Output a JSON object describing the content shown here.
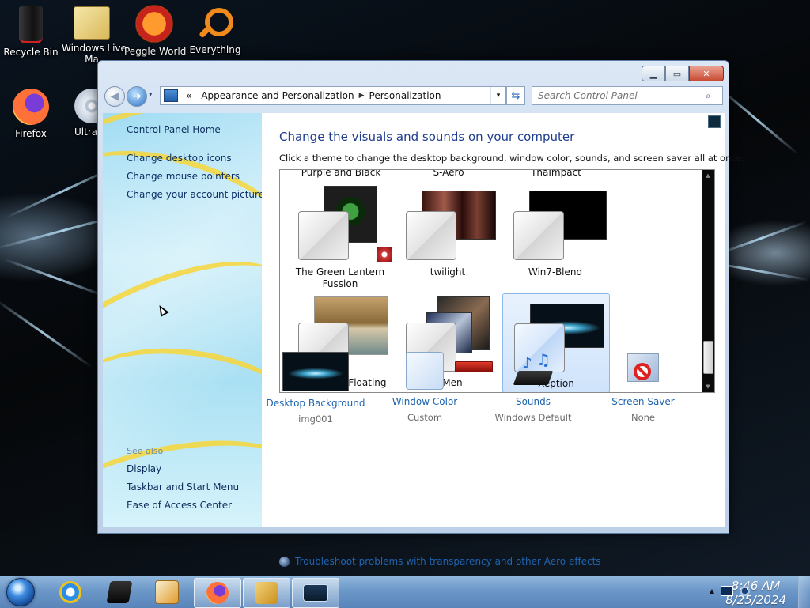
{
  "desktop": {
    "icons": [
      {
        "label": "Recycle Bin",
        "icon": "recycle-bin-icon"
      },
      {
        "label": "Windows Live",
        "label2": "Ma",
        "icon": "windows-live-mail-icon"
      },
      {
        "label": "Peggle World",
        "icon": "peggle-world-icon"
      },
      {
        "label": "Everything",
        "icon": "everything-search-icon"
      },
      {
        "label": "Firefox",
        "icon": "firefox-icon"
      },
      {
        "label": "Ultra",
        "icon": "ultraiso-disc-icon"
      }
    ]
  },
  "window": {
    "caption_buttons": {
      "minimize": "▁",
      "maximize": "▭",
      "close": "✕"
    },
    "nav": {
      "back": "◀",
      "forward": "➜",
      "history": "▾",
      "address_prefix": "«",
      "address_segments": [
        "Appearance and Personalization",
        "Personalization"
      ],
      "address_dropdown": "▾",
      "refresh": "⇆",
      "search_placeholder": "Search Control Panel",
      "search_icon": "⌕"
    },
    "left_pane": {
      "home": "Control Panel Home",
      "links": [
        "Change desktop icons",
        "Change mouse pointers",
        "Change your account picture"
      ],
      "see_also_label": "See also",
      "see_also_links": [
        "Display",
        "Taskbar and Start Menu",
        "Ease of Access Center"
      ]
    },
    "content": {
      "heading": "Change the visuals and sounds on your computer",
      "subheading": "Click a theme to change the desktop background, window color, sounds, and screen saver all at once.",
      "prev_row_labels": [
        "Purple and Black",
        "S-Aero",
        "ThaImpact"
      ],
      "themes": [
        {
          "name": "The Green Lantern Fussion",
          "selected": false
        },
        {
          "name": "twilight",
          "selected": false
        },
        {
          "name": "Win7-Blend",
          "selected": false
        },
        {
          "name": "Windows 8 Floating",
          "selected": false
        },
        {
          "name": "X-Men",
          "selected": false
        },
        {
          "name": "Xeption",
          "selected": true
        }
      ],
      "scroll_up": "▲",
      "scroll_down": "▼",
      "bottom_items": [
        {
          "title": "Desktop Background",
          "value": "img001"
        },
        {
          "title": "Window Color",
          "value": "Custom"
        },
        {
          "title": "Sounds",
          "value": "Windows Default"
        },
        {
          "title": "Screen Saver",
          "value": "None"
        }
      ],
      "troubleshoot": "Troubleshoot problems with transparency and other Aero effects"
    }
  },
  "taskbar": {
    "pinned": [
      {
        "icon": "internet-explorer-icon",
        "active": false
      },
      {
        "icon": "media-device-icon",
        "active": false
      },
      {
        "icon": "media-player-icon",
        "active": false
      },
      {
        "icon": "firefox-icon",
        "active": true
      },
      {
        "icon": "app-window-icon",
        "active": true
      },
      {
        "icon": "control-panel-window-icon",
        "active": true
      }
    ],
    "tray": {
      "arrow": "▲"
    },
    "clock": {
      "time": "8:46 AM",
      "date": "8/25/2024"
    }
  },
  "colors": {
    "link": "#1e64b0",
    "heading": "#1e3d8f",
    "selected_theme": "#cfe3fb"
  }
}
